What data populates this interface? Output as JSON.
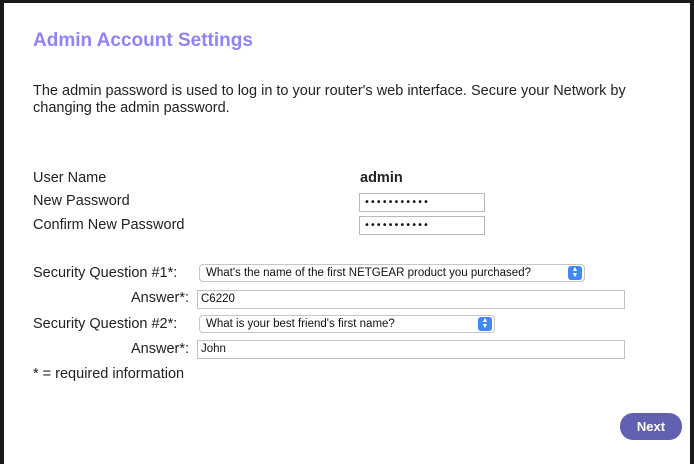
{
  "title": "Admin Account Settings",
  "description": "The admin password is used to log in to your router's web interface. Secure your Network by changing the admin password.",
  "fields": {
    "user_name_label": "User Name",
    "user_name_value": "admin",
    "new_password_label": "New Password",
    "new_password_value": "•••••••••••",
    "confirm_password_label": "Confirm New Password",
    "confirm_password_value": "•••••••••••"
  },
  "security": {
    "q1_label": "Security Question #1*:",
    "q1_selected": "What's the name of the first NETGEAR product you purchased?",
    "answer1_label": "Answer*:",
    "answer1_value": "C6220",
    "q2_label": "Security Question #2*:",
    "q2_selected": "What is your best friend's first name?",
    "answer2_label": "Answer*:",
    "answer2_value": "John"
  },
  "required_note": "* = required information",
  "next_label": "Next",
  "colors": {
    "title": "#8e84f5",
    "next_button": "#6260b0",
    "select_chevron": "#3e89f5"
  },
  "icons": {
    "select_chevron": "chevron-up-down-icon"
  }
}
